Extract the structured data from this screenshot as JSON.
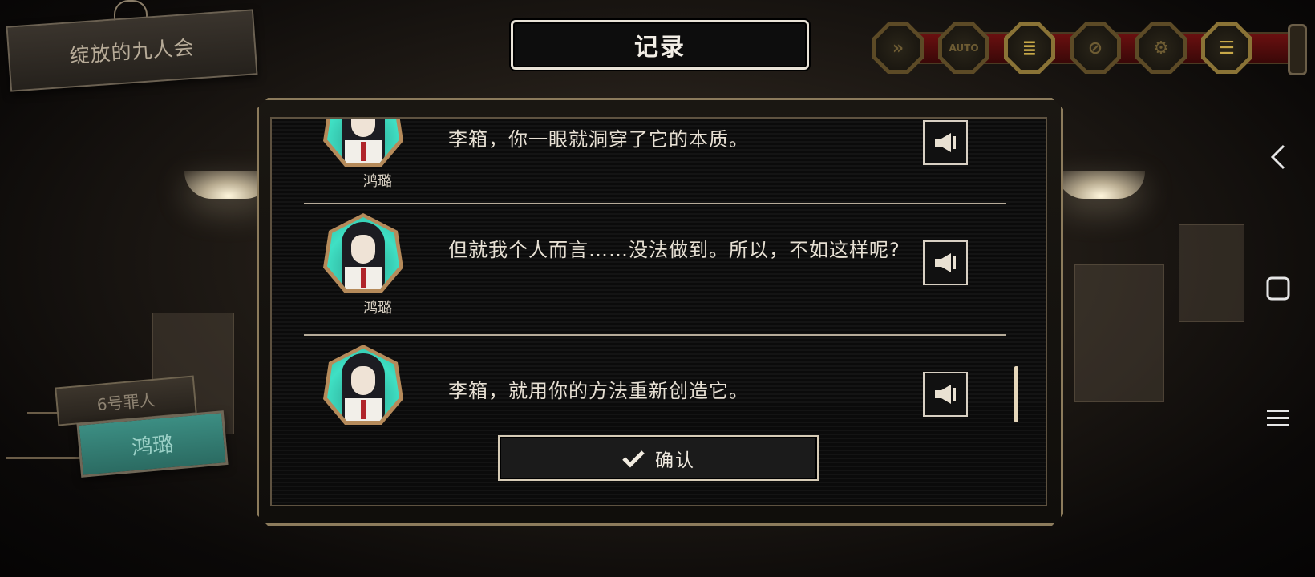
{
  "chapter": {
    "title": "绽放的九人会"
  },
  "header": {
    "title": "记录"
  },
  "toolbar": {
    "buttons": [
      {
        "name": "fast-forward",
        "glyph": "»"
      },
      {
        "name": "auto",
        "glyph": "AUTO"
      },
      {
        "name": "log",
        "glyph": "≣",
        "active": true
      },
      {
        "name": "hide-ui",
        "glyph": "⊘"
      },
      {
        "name": "settings",
        "glyph": "⚙"
      },
      {
        "name": "menu",
        "glyph": "☰",
        "active": true
      }
    ]
  },
  "left_panel": {
    "slot_label": "6号罪人",
    "character_name": "鸿璐"
  },
  "log": {
    "entries": [
      {
        "speaker": "鸿璐",
        "text": "李箱，你一眼就洞穿了它的本质。"
      },
      {
        "speaker": "鸿璐",
        "text": "但就我个人而言……没法做到。所以，不如这样呢?"
      },
      {
        "speaker": "",
        "text": "李箱，就用你的方法重新创造它。"
      }
    ],
    "confirm_label": "确认"
  },
  "colors": {
    "accent_gold": "#c8a948",
    "avatar_bg": "#3fe0c4",
    "name_plate": "#3c8e83",
    "rail_red": "#6b1010"
  },
  "system_nav": {
    "back": "‹",
    "home": "▢",
    "recents": "≡"
  }
}
